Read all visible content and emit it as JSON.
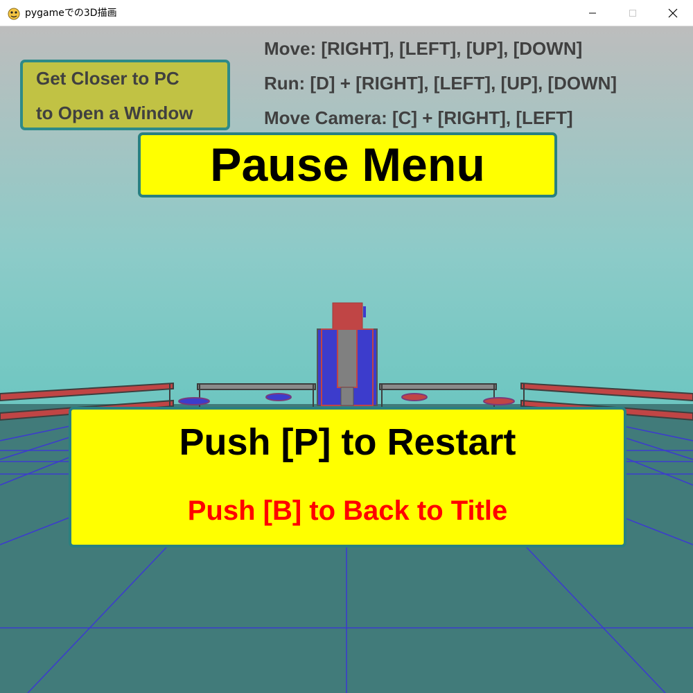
{
  "window": {
    "title": "pygameでの3D描画",
    "icon": "snake-icon",
    "controls": [
      "minimize",
      "maximize",
      "close"
    ]
  },
  "hud": {
    "hint_lines": [
      "Get Closer to PC",
      "to Open a Window"
    ],
    "control_lines": [
      "Move: [RIGHT], [LEFT], [UP], [DOWN]",
      "Run: [D] + [RIGHT], [LEFT], [UP], [DOWN]",
      "Move Camera: [C] + [RIGHT], [LEFT]"
    ]
  },
  "pause_menu": {
    "title": "Pause Menu",
    "restart_label": "Push [P] to Restart",
    "back_label": "Push [B] to Back to Title"
  },
  "colors": {
    "panel_yellow": "#ffff00",
    "panel_border": "#2a8080",
    "hint_bg": "#c1c244",
    "hud_text": "#404040",
    "back_text": "#ff0000",
    "sky_top": "#bcbcbc",
    "sky_bottom": "#6fc7c2",
    "floor": "#417b7a",
    "grid_lines": "#3c3ccc"
  }
}
